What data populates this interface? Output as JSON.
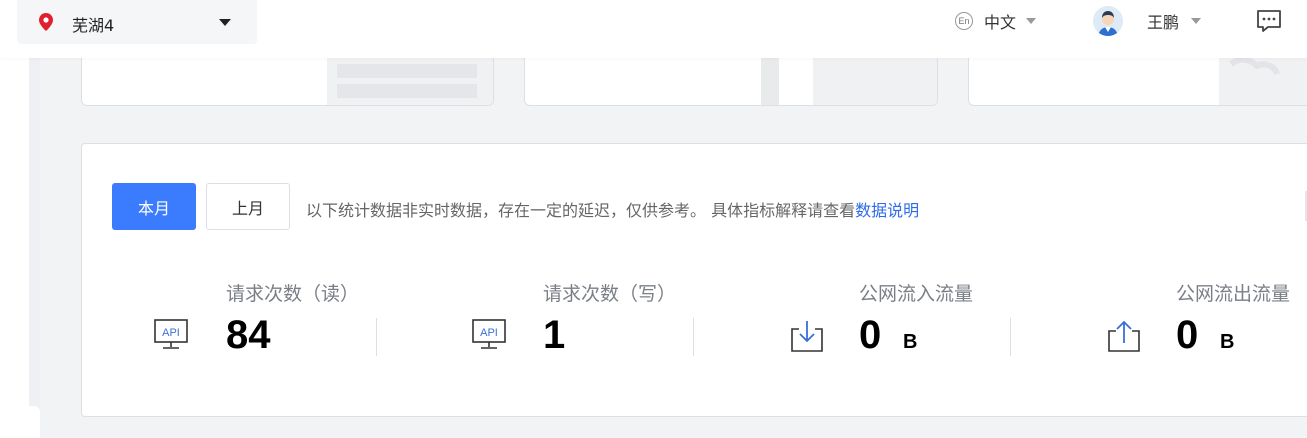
{
  "header": {
    "region": "芜湖4",
    "language": "中文",
    "language_badge": "En",
    "user_name": "王鹏"
  },
  "filters": {
    "this_month": "本月",
    "last_month": "上月",
    "note": "以下统计数据非实时数据，存在一定的延迟，仅供参考。 具体指标解释请查看",
    "link": "数据说明"
  },
  "stats": [
    {
      "title": "请求次数（读）",
      "icon": "api-monitor-icon",
      "value": "84",
      "unit": ""
    },
    {
      "title": "请求次数（写）",
      "icon": "api-monitor-icon",
      "value": "1",
      "unit": ""
    },
    {
      "title": "公网流入流量",
      "icon": "download-icon",
      "value": "0",
      "unit": "B"
    },
    {
      "title": "公网流出流量",
      "icon": "upload-icon",
      "value": "0",
      "unit": "B"
    }
  ],
  "api_icon_text": "API",
  "colors": {
    "primary": "#3b7cff",
    "link": "#2e6be6",
    "pin": "#e0202f",
    "icon_blue": "#3a6fd8"
  }
}
